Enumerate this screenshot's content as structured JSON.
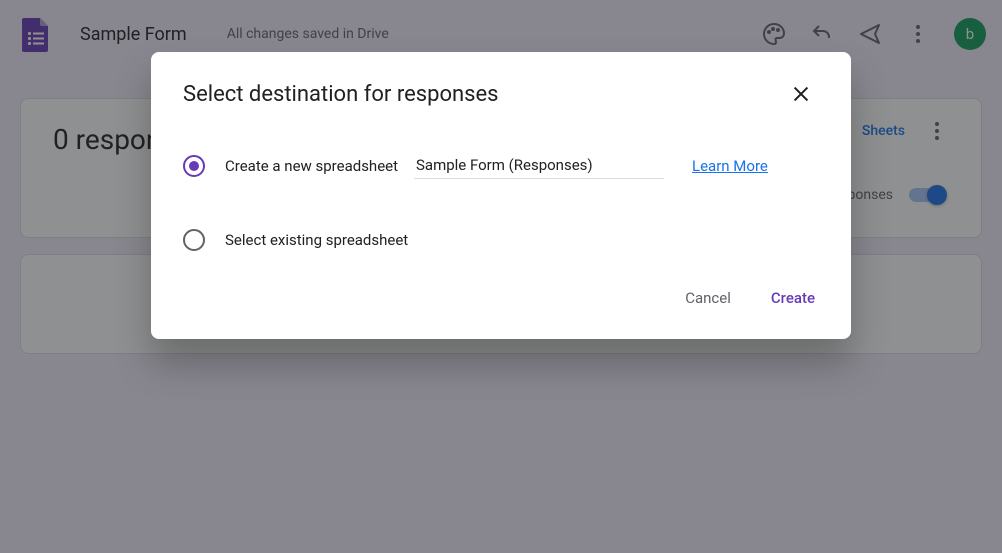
{
  "header": {
    "title": "Sample Form",
    "save_status": "All changes saved in Drive",
    "avatar_letter": "b"
  },
  "responses": {
    "title": "0 responses",
    "sheets_link": "Sheets",
    "accepting_label": "Accepting responses"
  },
  "dialog": {
    "title": "Select destination for responses",
    "option_new": "Create a new spreadsheet",
    "new_sheet_name": "Sample Form (Responses)",
    "learn_more": "Learn More",
    "option_existing": "Select existing spreadsheet",
    "cancel": "Cancel",
    "create": "Create"
  }
}
